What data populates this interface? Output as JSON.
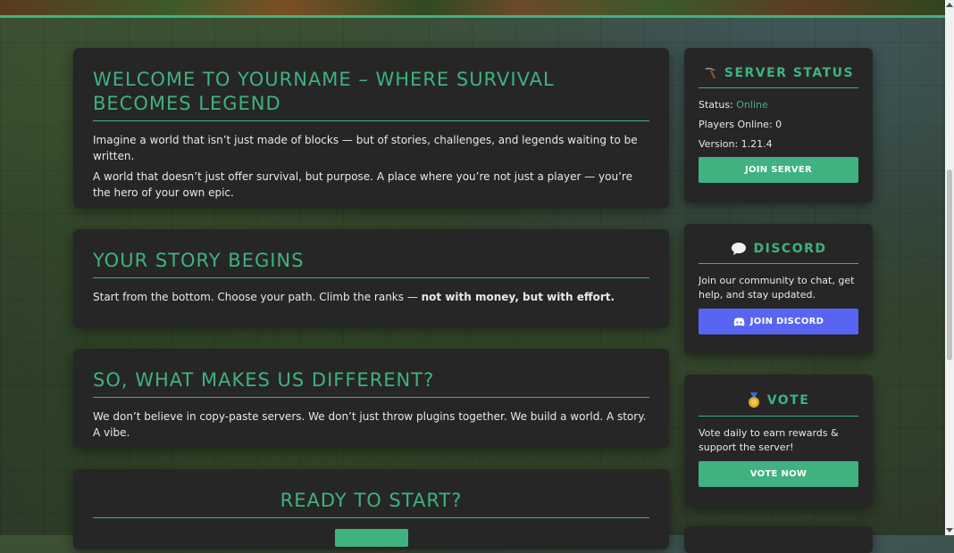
{
  "main": {
    "welcome": {
      "title": "WELCOME TO YOURNAME – WHERE SURVIVAL BECOMES LEGEND",
      "p1": "Imagine a world that isn’t just made of blocks — but of stories, challenges, and legends waiting to be written.",
      "p2": "A world that doesn’t just offer survival, but purpose. A place where you’re not just a player — you’re the hero of your own epic."
    },
    "story": {
      "title": "YOUR STORY BEGINS",
      "text": "Start from the bottom. Choose your path. Climb the ranks — ",
      "bold": "not with money, but with effort."
    },
    "different": {
      "title": "SO, WHAT MAKES US DIFFERENT?",
      "text": "We don’t believe in copy-paste servers. We don’t just throw plugins together. We build a world. A story. A vibe."
    },
    "ready": {
      "title": "READY TO START?"
    }
  },
  "sidebar": {
    "status": {
      "title": "SERVER STATUS",
      "icon": "pickaxe-icon",
      "status_label": "Status:",
      "status_value": "Online",
      "players_label": "Players Online:",
      "players_value": "0",
      "version_label": "Version:",
      "version_value": "1.21.4",
      "button": "JOIN SERVER"
    },
    "discord": {
      "title": "DISCORD",
      "icon": "speech-bubble-icon",
      "text": "Join our community to chat, get help, and stay updated.",
      "button": "JOIN DISCORD"
    },
    "vote": {
      "title": "VOTE",
      "icon": "medal-icon",
      "text": "Vote daily to earn rewards & support the server!",
      "button": "VOTE NOW"
    }
  },
  "colors": {
    "accent": "#3fb27f",
    "panel": "#262626",
    "discord": "#5865f2",
    "online": "#3fb27f"
  }
}
